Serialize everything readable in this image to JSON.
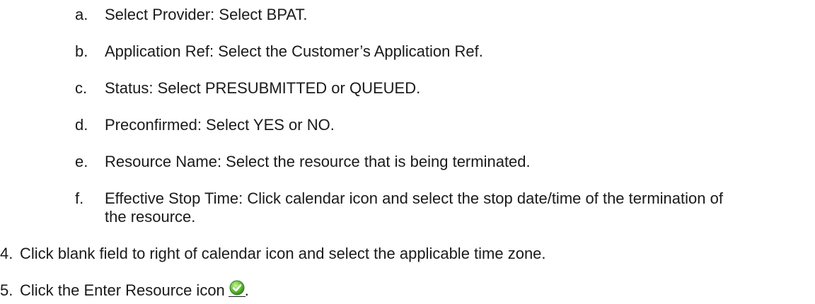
{
  "sub_steps": [
    {
      "marker": "a.",
      "text": "Select Provider:  Select BPAT."
    },
    {
      "marker": "b.",
      "text": "Application Ref:  Select the Customer’s Application Ref."
    },
    {
      "marker": "c.",
      "text": "Status:  Select PRESUBMITTED or QUEUED."
    },
    {
      "marker": "d.",
      "text": "Preconfirmed:  Select YES or NO."
    },
    {
      "marker": "e.",
      "text": "Resource Name:  Select the resource that is being terminated."
    },
    {
      "marker": "f.",
      "text": "Effective Stop Time:  Click calendar icon and select the stop date/time of the termination of the resource."
    }
  ],
  "steps": [
    {
      "marker": "4.",
      "text": "Click blank field to right of calendar icon and select the applicable time zone."
    },
    {
      "marker": "5.",
      "text": "Click the Enter Resource icon",
      "suffix": ".",
      "icon": "enter-resource-check-icon"
    }
  ]
}
